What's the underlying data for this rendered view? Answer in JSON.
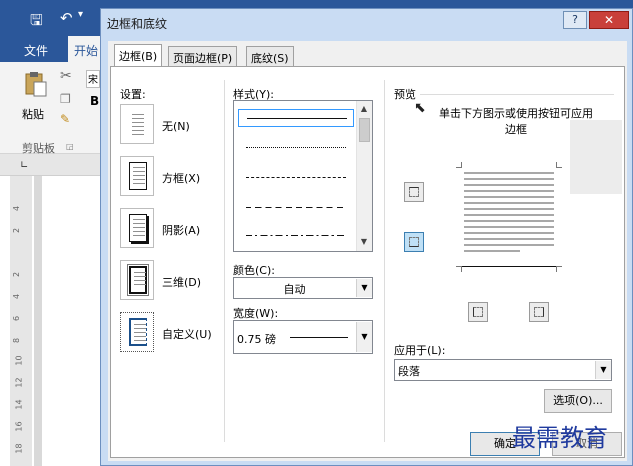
{
  "word": {
    "tab_file": "文件",
    "tab_home": "开始",
    "paste": "粘贴",
    "clipboard": "剪贴板",
    "font_box": "宋",
    "bold": "B",
    "ruler_numbers": [
      "4",
      "2",
      "2",
      "4",
      "6",
      "8",
      "10",
      "12",
      "14",
      "16",
      "18"
    ]
  },
  "dialog": {
    "title": "边框和底纹",
    "help": "?",
    "close": "✕",
    "tabs": [
      {
        "label": "边框(B)",
        "active": true
      },
      {
        "label": "页面边框(P)",
        "active": false
      },
      {
        "label": "底纹(S)",
        "active": false
      }
    ]
  },
  "settings": {
    "heading": "设置:",
    "items": [
      {
        "label": "无(N)",
        "icon": "none-border-icon"
      },
      {
        "label": "方框(X)",
        "icon": "box-border-icon"
      },
      {
        "label": "阴影(A)",
        "icon": "shadow-border-icon"
      },
      {
        "label": "三维(D)",
        "icon": "3d-border-icon"
      },
      {
        "label": "自定义(U)",
        "icon": "custom-border-icon"
      }
    ]
  },
  "style": {
    "heading": "样式(Y):",
    "lines": [
      "solid",
      "dotted",
      "small-dash",
      "dash",
      "dash-dot"
    ]
  },
  "color": {
    "label": "颜色(C):",
    "value": "自动"
  },
  "width": {
    "label": "宽度(W):",
    "value": "0.75 磅"
  },
  "preview": {
    "heading": "预览",
    "hint": "单击下方图示或使用按钮可应用边框"
  },
  "apply_to": {
    "label": "应用于(L):",
    "value": "段落"
  },
  "buttons": {
    "options": "选项(O)...",
    "ok": "确定",
    "cancel": "取消"
  },
  "watermark": "最需教育"
}
